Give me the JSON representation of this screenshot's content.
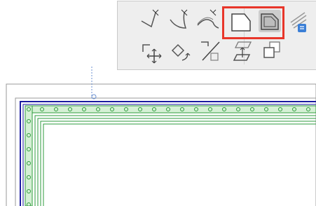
{
  "app": {
    "view": "floor-plan-canvas"
  },
  "toolbar": {
    "row1": [
      {
        "id": "corner-polygon-line",
        "icon": "polygon-corner-icon"
      },
      {
        "id": "arc-polygon-line",
        "icon": "polygon-arc-icon"
      },
      {
        "id": "spline-polygon-line",
        "icon": "polygon-spline-icon"
      },
      {
        "id": "fillet-chamfer",
        "icon": "chamfer-icon"
      },
      {
        "id": "fillet-chamfer-filled",
        "icon": "chamfer-filled-icon",
        "active": true
      },
      {
        "id": "surface-settings",
        "icon": "surface-settings-icon"
      }
    ],
    "row2": [
      {
        "id": "drag",
        "icon": "drag-move-icon"
      },
      {
        "id": "rotate",
        "icon": "rotate-icon"
      },
      {
        "id": "mirror",
        "icon": "mirror-icon"
      },
      {
        "id": "elevate",
        "icon": "elevate-icon"
      },
      {
        "id": "multiply",
        "icon": "multiply-copy-icon"
      }
    ]
  },
  "colors": {
    "toolbar_bg": "#eeeeee",
    "highlight": "#e8362a",
    "selection_blue": "#1a1aa0",
    "element_green": "#2e9b3c",
    "guide_blue": "#6a8fd0",
    "frame_gray": "#999999"
  }
}
